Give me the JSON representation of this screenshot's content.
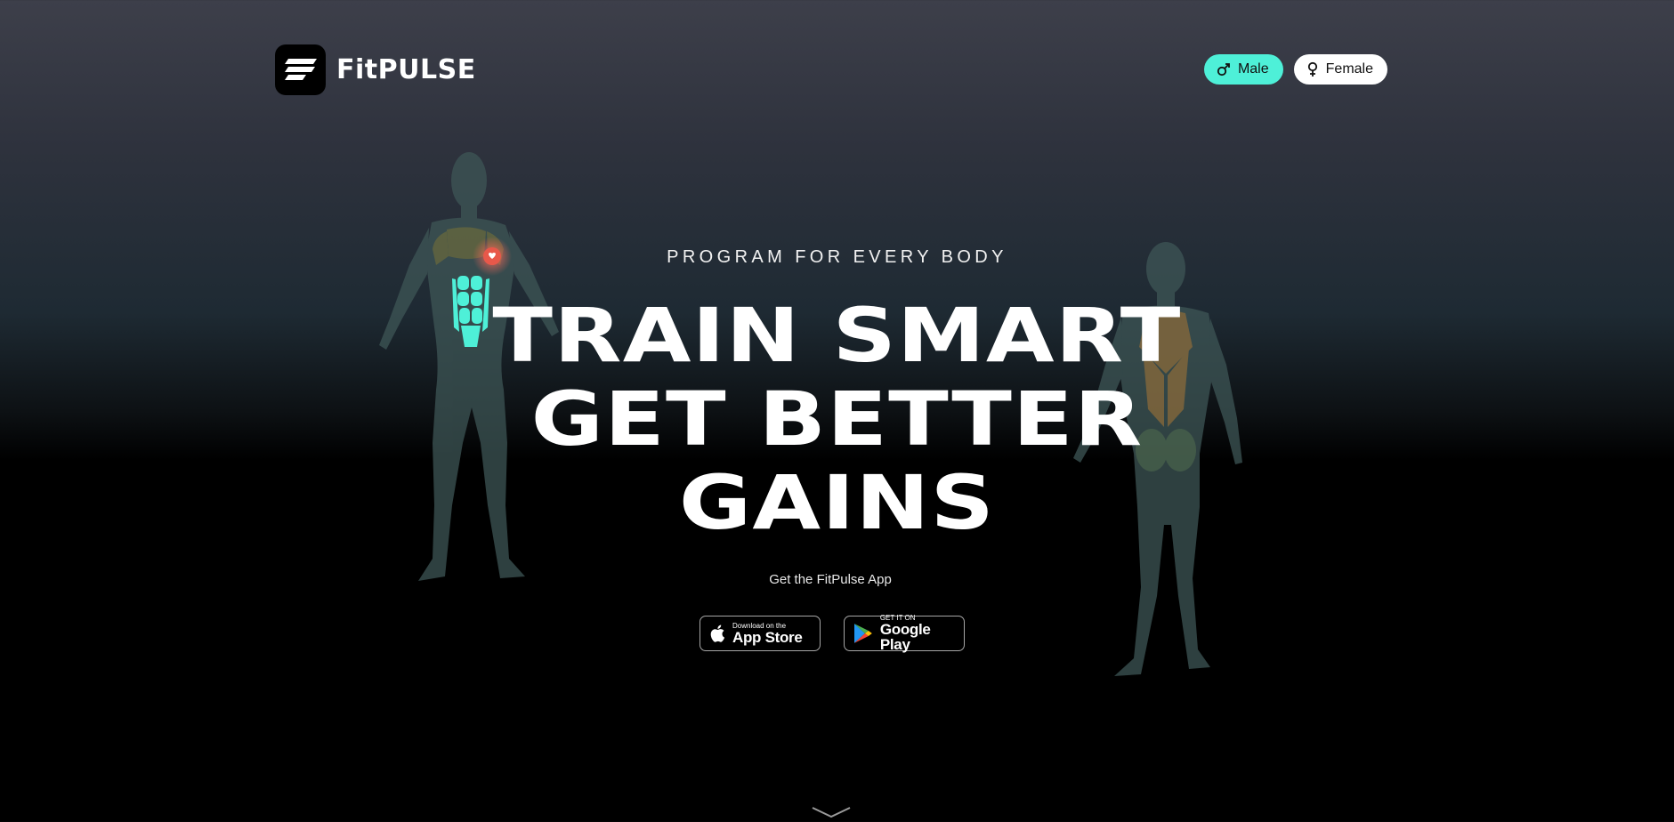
{
  "header": {
    "logo_text": "FitPULSE",
    "gender_options": [
      {
        "label": "Male",
        "icon": "male-icon",
        "selected": true
      },
      {
        "label": "Female",
        "icon": "female-icon",
        "selected": false
      }
    ]
  },
  "hero": {
    "eyebrow": "PROGRAM FOR EVERY BODY",
    "headline_lines": [
      "TRAIN SMART",
      "GET BETTER",
      "GAINS"
    ],
    "cta_label": "Get the FitPulse App",
    "app_store": {
      "small": "Download on the",
      "big": "App Store",
      "icon": "apple-icon"
    },
    "google_play": {
      "small": "GET IT ON",
      "big": "Google Play",
      "icon": "google-play-icon"
    }
  },
  "colors": {
    "accent": "#4ef0d8",
    "heart": "#e8584a",
    "muscle_highlight": "#d7a04a"
  }
}
